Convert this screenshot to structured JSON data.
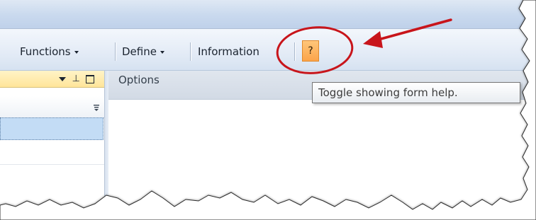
{
  "menu": {
    "items": [
      {
        "label": "Functions",
        "dropdown": true
      },
      {
        "label": "Define",
        "dropdown": true
      },
      {
        "label": "Information",
        "dropdown": false
      }
    ],
    "help_button_label": "?",
    "help_button_color": "#fba44a"
  },
  "left_panel": {
    "header_icons": [
      "dropdown-arrow-icon",
      "pin-icon",
      "maximize-icon"
    ],
    "header_color": "#ffe59a",
    "selected_row_color": "#c3dcf5"
  },
  "options_panel": {
    "title": "Options"
  },
  "tooltip": {
    "text": "Toggle showing form help."
  },
  "annotation": {
    "color": "#c8151b",
    "shapes": [
      "circle",
      "arrow"
    ]
  }
}
